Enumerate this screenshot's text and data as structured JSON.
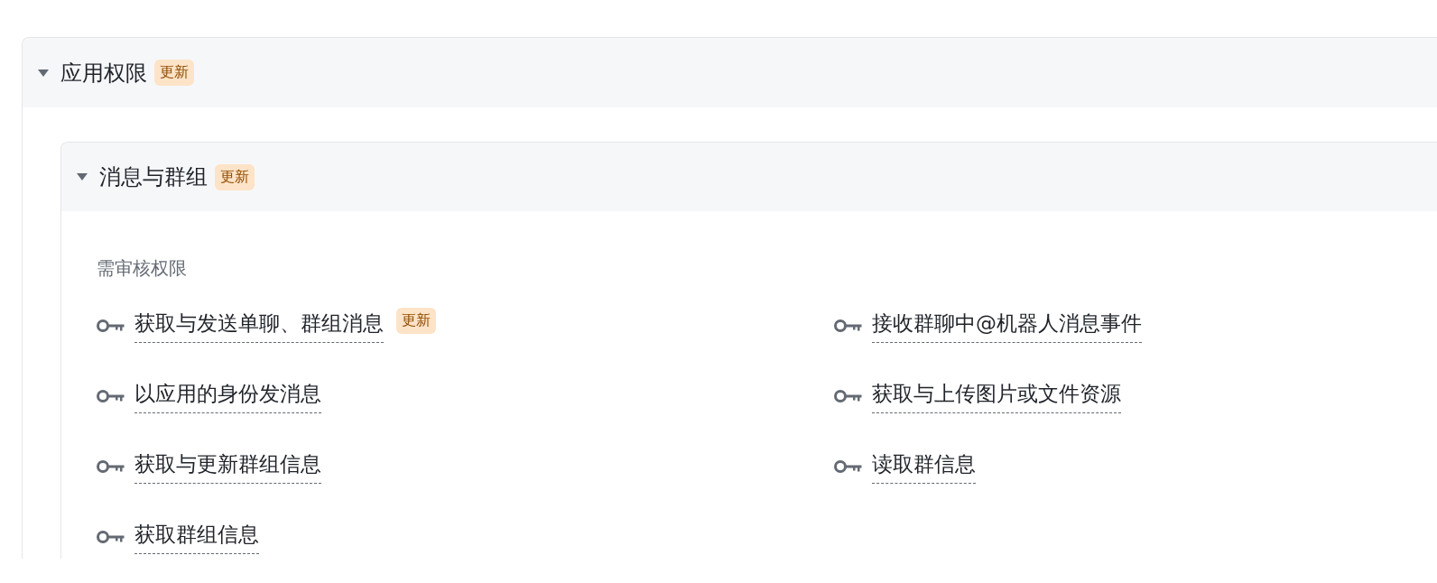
{
  "section": {
    "title": "应用权限",
    "badge": "更新",
    "expanded": true,
    "group": {
      "title": "消息与群组",
      "badge": "更新",
      "expanded": true,
      "subheading": "需审核权限",
      "permissions": [
        {
          "label": "获取与发送单聊、群组消息",
          "badge": "更新"
        },
        {
          "label": "接收群聊中@机器人消息事件"
        },
        {
          "label": "以应用的身份发消息"
        },
        {
          "label": "获取与上传图片或文件资源"
        },
        {
          "label": "获取与更新群组信息"
        },
        {
          "label": "读取群信息"
        },
        {
          "label": "获取群组信息"
        }
      ]
    }
  }
}
